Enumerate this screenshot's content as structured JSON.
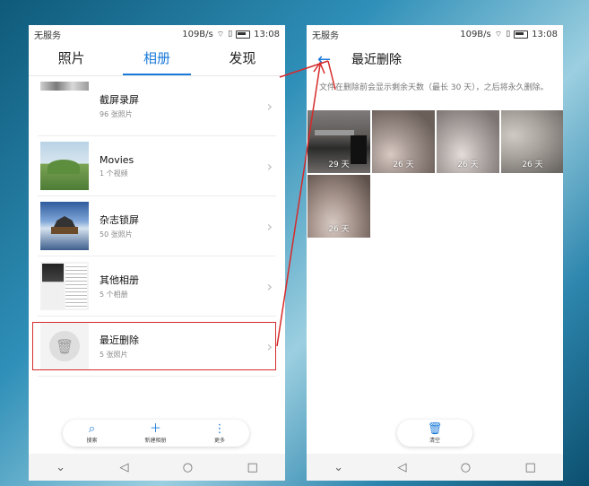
{
  "colors": {
    "accent": "#1a7ad9",
    "annotation": "#d62a2a"
  },
  "status": {
    "carrier": "无服务",
    "speed": "109B/s",
    "time": "13:08",
    "icons": [
      "wifi-icon",
      "sim-icon",
      "battery-icon"
    ]
  },
  "left": {
    "tabs": [
      {
        "label": "照片",
        "active": false
      },
      {
        "label": "相册",
        "active": true
      },
      {
        "label": "发现",
        "active": false
      }
    ],
    "albums": [
      {
        "name": "截屏录屏",
        "count": "96 张照片"
      },
      {
        "name": "Movies",
        "count": "1 个视频"
      },
      {
        "name": "杂志锁屏",
        "count": "50 张照片"
      },
      {
        "name": "其他相册",
        "count": "5 个相册"
      },
      {
        "name": "最近删除",
        "count": "5 张照片"
      }
    ],
    "toolbar": [
      {
        "icon": "search-icon",
        "label": "搜索"
      },
      {
        "icon": "plus-icon",
        "label": "新建相册"
      },
      {
        "icon": "more-icon",
        "label": "更多"
      }
    ]
  },
  "right": {
    "title": "最近删除",
    "info": "文件在删除前会显示剩余天数（最长 30 天），之后将永久删除。",
    "photos": [
      {
        "days": "29 天"
      },
      {
        "days": "26 天"
      },
      {
        "days": "26 天"
      },
      {
        "days": "26 天"
      },
      {
        "days": "26 天"
      }
    ],
    "clear_label": "清空"
  },
  "nav": {
    "icons": [
      "chevron-down-icon",
      "back-triangle-icon",
      "home-circle-icon",
      "recents-square-icon"
    ]
  }
}
